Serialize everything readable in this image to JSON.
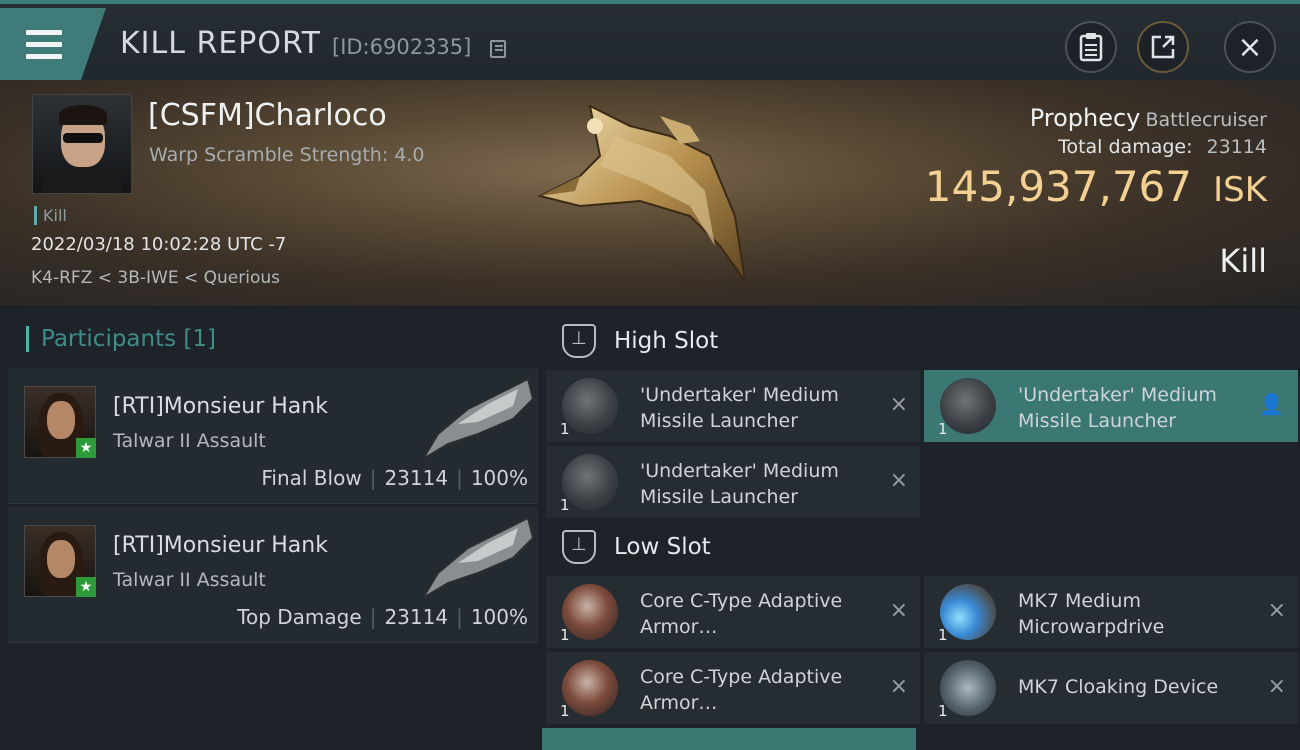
{
  "header": {
    "title": "KILL REPORT",
    "report_id": "[ID:6902335]"
  },
  "victim": {
    "name": "[CSFM]Charloco",
    "warp_scramble": "Warp Scramble Strength: 4.0",
    "type_tag": "Kill",
    "datetime": "2022/03/18 10:02:28 UTC -7",
    "location": "K4-RFZ < 3B-IWE < Querious",
    "ship_name": "Prophecy",
    "ship_class": "Battlecruiser",
    "total_damage_label": "Total damage:",
    "total_damage": "23114",
    "isk_value": "145,937,767",
    "isk_unit": "ISK",
    "result": "Kill"
  },
  "participants": {
    "heading": "Participants [1]",
    "rows": [
      {
        "name": "[RTI]Monsieur Hank",
        "ship": "Talwar II Assault",
        "tag": "Final Blow",
        "damage": "23114",
        "percent": "100%"
      },
      {
        "name": "[RTI]Monsieur Hank",
        "ship": "Talwar II Assault",
        "tag": "Top Damage",
        "damage": "23114",
        "percent": "100%"
      }
    ]
  },
  "fitting": {
    "high_slot_label": "High Slot",
    "low_slot_label": "Low Slot",
    "high": [
      {
        "name": "'Undertaker' Medium Missile Launcher",
        "qty": "1"
      },
      {
        "name": "'Undertaker' Medium Missile Launcher",
        "qty": "1"
      },
      {
        "name": "'Undertaker' Medium Missile Launcher",
        "qty": "1"
      }
    ],
    "low": [
      {
        "name": "Core C-Type Adaptive Armor…",
        "qty": "1"
      },
      {
        "name": "MK7 Medium Microwarpdrive",
        "qty": "1"
      },
      {
        "name": "Core C-Type Adaptive Armor…",
        "qty": "1"
      },
      {
        "name": "MK7 Cloaking Device",
        "qty": "1"
      }
    ]
  },
  "icons": {
    "close": "×",
    "user": "👤",
    "star": "★"
  },
  "colors": {
    "accent_teal": "#3b7773",
    "isk_gold": "#f4d193"
  }
}
